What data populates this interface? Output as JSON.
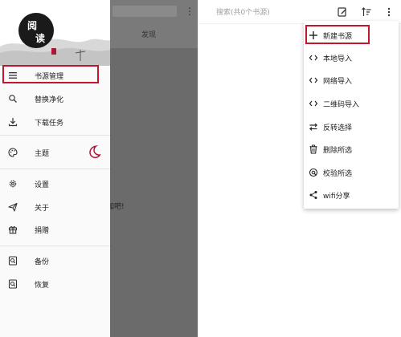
{
  "background_screen": {
    "tab_label": "发现",
    "empty_text": "添加吧!"
  },
  "drawer": {
    "logo_text": "阅读",
    "items": [
      {
        "icon": "list-icon",
        "label": "书源管理"
      },
      {
        "icon": "replace-icon",
        "label": "替换净化"
      },
      {
        "icon": "download-icon",
        "label": "下载任务"
      },
      {
        "icon": "palette-icon",
        "label": "主题"
      },
      {
        "icon": "gear-icon",
        "label": "设置"
      },
      {
        "icon": "send-icon",
        "label": "关于"
      },
      {
        "icon": "gift-icon",
        "label": "捐赠"
      },
      {
        "icon": "backup-icon",
        "label": "备份"
      },
      {
        "icon": "restore-icon",
        "label": "恢复"
      }
    ]
  },
  "source_manager": {
    "search_placeholder": "搜索(共0个书源)",
    "menu": [
      {
        "icon": "plus-icon",
        "label": "新建书源"
      },
      {
        "icon": "code-icon",
        "label": "本地导入"
      },
      {
        "icon": "code-icon",
        "label": "网络导入"
      },
      {
        "icon": "code-icon",
        "label": "二维码导入"
      },
      {
        "icon": "swap-icon",
        "label": "反转选择"
      },
      {
        "icon": "trash-icon",
        "label": "删除所选"
      },
      {
        "icon": "verify-icon",
        "label": "校验所选"
      },
      {
        "icon": "share-icon",
        "label": "wifi分享"
      }
    ]
  },
  "colors": {
    "highlight": "#c4162a",
    "accent": "#b0143a"
  }
}
